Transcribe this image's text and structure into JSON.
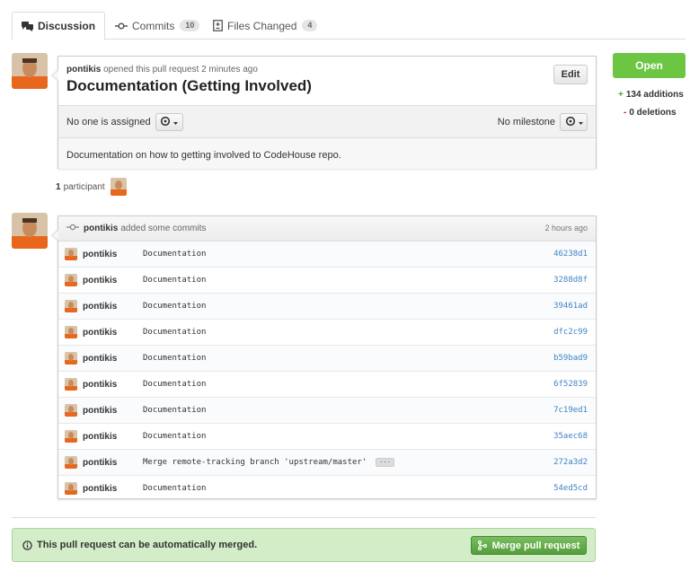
{
  "tabs": [
    {
      "label": "Discussion",
      "active": true
    },
    {
      "label": "Commits",
      "count": "10"
    },
    {
      "label": "Files Changed",
      "count": "4"
    }
  ],
  "pull_request": {
    "author": "pontikis",
    "opened_text": "opened this pull request 2 minutes ago",
    "title": "Documentation (Getting Involved)",
    "edit_label": "Edit",
    "assignee_text": "No one is assigned",
    "milestone_text": "No milestone",
    "body": "Documentation on how to getting involved to CodeHouse repo."
  },
  "participants": {
    "count": "1",
    "label": "participant"
  },
  "commits_box": {
    "author": "pontikis",
    "action": "added some commits",
    "time": "2 hours ago",
    "commits": [
      {
        "author": "pontikis",
        "message": "Documentation",
        "sha": "46238d1"
      },
      {
        "author": "pontikis",
        "message": "Documentation",
        "sha": "3288d8f"
      },
      {
        "author": "pontikis",
        "message": "Documentation",
        "sha": "39461ad"
      },
      {
        "author": "pontikis",
        "message": "Documentation",
        "sha": "dfc2c99"
      },
      {
        "author": "pontikis",
        "message": "Documentation",
        "sha": "b59bad9"
      },
      {
        "author": "pontikis",
        "message": "Documentation",
        "sha": "6f52839"
      },
      {
        "author": "pontikis",
        "message": "Documentation",
        "sha": "7c19ed1"
      },
      {
        "author": "pontikis",
        "message": "Documentation",
        "sha": "35aec68"
      },
      {
        "author": "pontikis",
        "message": "Merge remote-tracking branch 'upstream/master'",
        "sha": "272a3d2",
        "ellipsis": "···"
      },
      {
        "author": "pontikis",
        "message": "Documentation",
        "sha": "54ed5cd"
      }
    ]
  },
  "merge": {
    "message": "This pull request can be automatically merged.",
    "button_label": "Merge pull request"
  },
  "sidebar": {
    "state": "Open",
    "additions": "134 additions",
    "deletions": "0 deletions",
    "add_sign": "+",
    "del_sign": "-"
  },
  "colors": {
    "open_green": "#6cc644",
    "link_blue": "#4183c4",
    "merge_bg": "#d4edc9"
  }
}
